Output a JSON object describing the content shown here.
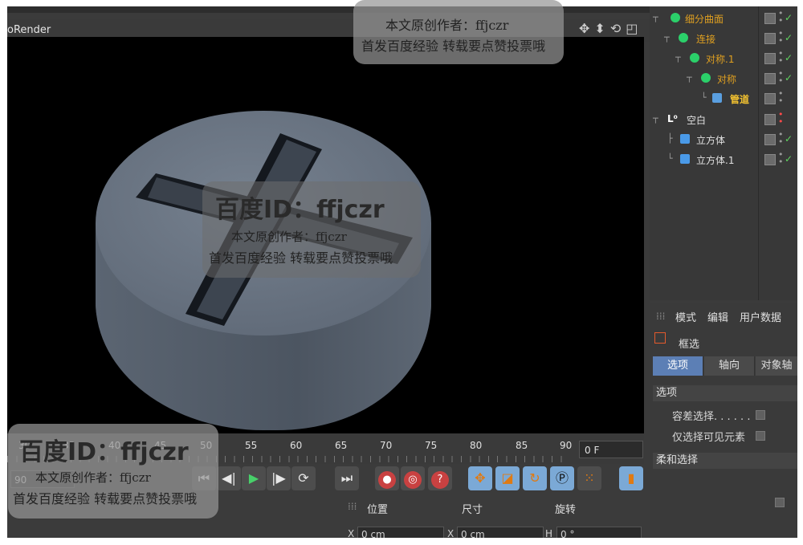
{
  "viewport": {
    "title": "oRender",
    "icons": [
      "move-view-icon",
      "dolly-view-icon",
      "rotate-view-icon",
      "maximize-view-icon"
    ]
  },
  "object_manager": {
    "rows": [
      {
        "label": "细分曲面",
        "color": "#e0a020"
      },
      {
        "label": "连接",
        "color": "#e0a020"
      },
      {
        "label": "对称.1",
        "color": "#e0a020"
      },
      {
        "label": "对称",
        "color": "#e0a020"
      },
      {
        "label": "管道",
        "color": "#f0c030"
      },
      {
        "label": "空白",
        "color": "#e0e0e0"
      },
      {
        "label": "立方体",
        "color": "#e0e0e0"
      },
      {
        "label": "立方体.1",
        "color": "#e0e0e0"
      }
    ]
  },
  "attribute_manager": {
    "menu": [
      "模式",
      "编辑",
      "用户数据"
    ],
    "tool": "框选",
    "tabs": [
      "选项",
      "轴向",
      "对象轴"
    ],
    "section1": "选项",
    "option1": "容差选择. . . . . .",
    "option2": "仅选择可见元素",
    "section2": "柔和选择"
  },
  "timeline": {
    "ruler": [
      "30",
      "35",
      "40",
      "45",
      "50",
      "55",
      "60",
      "65",
      "70",
      "75",
      "80",
      "85",
      "90"
    ],
    "current_frame": "0 F",
    "end_frame": "90"
  },
  "coordinates": {
    "headers": [
      "位置",
      "尺寸",
      "旋转"
    ],
    "fields": [
      {
        "axis": "X",
        "value": "0 cm"
      },
      {
        "axis": "X",
        "value": "0 cm"
      },
      {
        "axis": "H",
        "value": "0 °"
      }
    ]
  },
  "watermark": {
    "id_text": "百度ID：ffjczr",
    "line1": "本文原创作者：ffjczr",
    "line2": "首发百度经验  转载要点赞投票哦",
    "top_id_partial": "ffjczr"
  }
}
